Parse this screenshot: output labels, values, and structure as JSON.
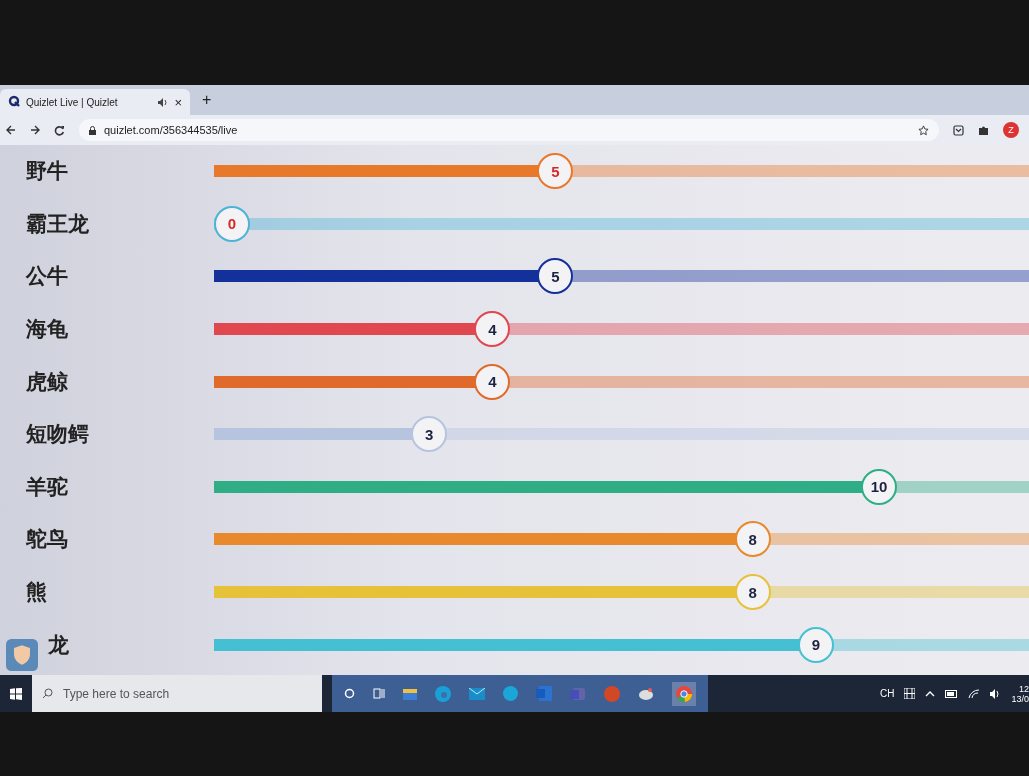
{
  "browser": {
    "tab_title": "Quizlet Live | Quizlet",
    "tab_close": "×",
    "new_tab": "+",
    "url": "quizlet.com/356344535/live",
    "profile_initial": "Z"
  },
  "teams": [
    {
      "name": "野牛",
      "score": "5",
      "level": 0.41,
      "color": "#e8782a",
      "highlighted": true
    },
    {
      "name": "霸王龙",
      "score": "0",
      "level": 0,
      "color": "#4db3d6",
      "highlighted": true
    },
    {
      "name": "公牛",
      "score": "5",
      "level": 0.41,
      "color": "#14309a",
      "highlighted": false
    },
    {
      "name": "海龟",
      "score": "4",
      "level": 0.33,
      "color": "#e0474f",
      "highlighted": false
    },
    {
      "name": "虎鲸",
      "score": "4",
      "level": 0.33,
      "color": "#e06a2c",
      "highlighted": false
    },
    {
      "name": "短吻鳄",
      "score": "3",
      "level": 0.25,
      "color": "#b6c4e0",
      "highlighted": false
    },
    {
      "name": "羊驼",
      "score": "10",
      "level": 0.82,
      "color": "#2fae86",
      "highlighted": false
    },
    {
      "name": "鸵鸟",
      "score": "8",
      "level": 0.66,
      "color": "#e8892e",
      "highlighted": false
    },
    {
      "name": "熊",
      "score": "8",
      "level": 0.66,
      "color": "#e6c23a",
      "highlighted": false
    },
    {
      "name": "龙",
      "score": "9",
      "level": 0.74,
      "color": "#45c0d2",
      "highlighted": false
    }
  ],
  "taskbar": {
    "search_placeholder": "Type here to search",
    "language": "CH",
    "time": "12",
    "date": "13/0"
  }
}
